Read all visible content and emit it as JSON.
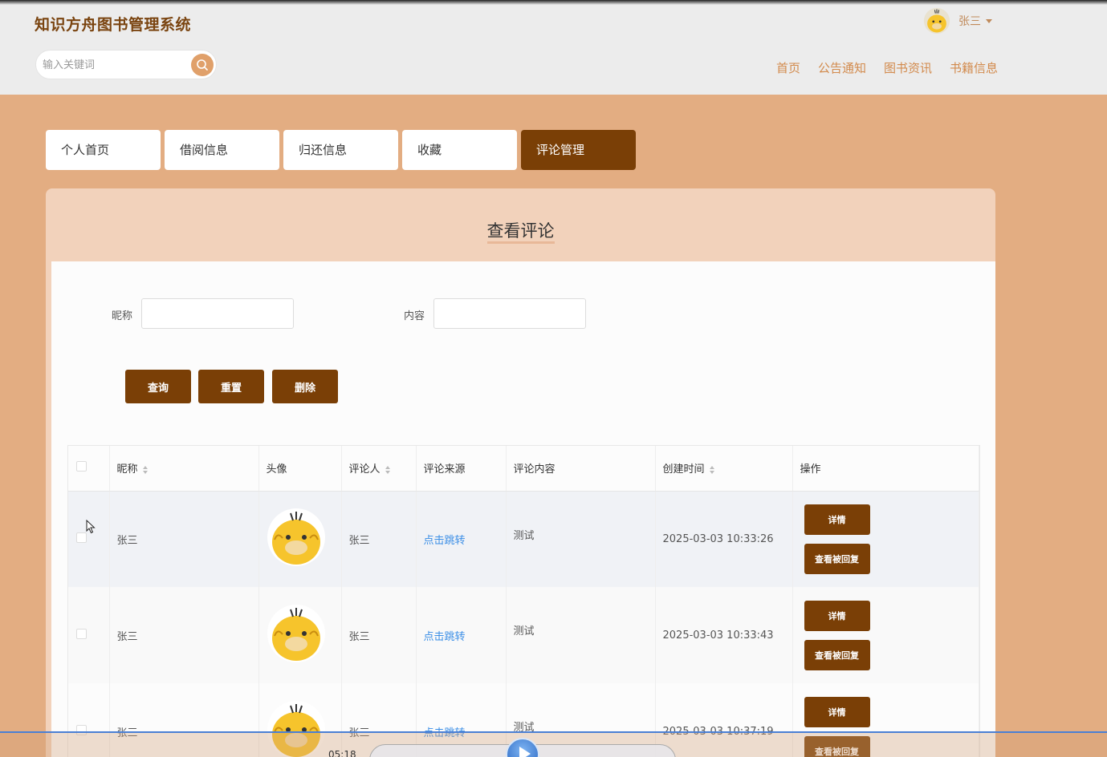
{
  "header": {
    "site_title": "知识方舟图书管理系统",
    "search_placeholder": "输入关键词",
    "user_name": "张三",
    "nav": [
      "首页",
      "公告通知",
      "图书资讯",
      "书籍信息"
    ]
  },
  "tabs": [
    {
      "label": "个人首页",
      "active": false
    },
    {
      "label": "借阅信息",
      "active": false
    },
    {
      "label": "归还信息",
      "active": false
    },
    {
      "label": "收藏",
      "active": false
    },
    {
      "label": "评论管理",
      "active": true
    }
  ],
  "panel": {
    "title": "查看评论",
    "filters": {
      "nickname_label": "昵称",
      "nickname_value": "",
      "content_label": "内容",
      "content_value": ""
    },
    "buttons": {
      "query": "查询",
      "reset": "重置",
      "delete": "删除"
    }
  },
  "table": {
    "columns": [
      "昵称",
      "头像",
      "评论人",
      "评论来源",
      "评论内容",
      "创建时间",
      "操作"
    ],
    "rows": [
      {
        "nickname": "张三",
        "commenter": "张三",
        "source": "点击跳转",
        "content": "测试",
        "created": "2025-03-03 10:33:26"
      },
      {
        "nickname": "张三",
        "commenter": "张三",
        "source": "点击跳转",
        "content": "测试",
        "created": "2025-03-03 10:33:43"
      },
      {
        "nickname": "张三",
        "commenter": "张三",
        "source": "点击跳转",
        "content": "测试",
        "created": "2025-03-03 10:37:19"
      }
    ],
    "actions": {
      "detail": "详情",
      "view_reply": "查看被回复"
    }
  },
  "player": {
    "time": "05:18"
  },
  "colors": {
    "brand_dark": "#7a3f06",
    "page_bg": "#e3ad82",
    "panel_header": "#f2d2bb",
    "nav_text": "#d28a4c",
    "link": "#3a8ee6"
  }
}
